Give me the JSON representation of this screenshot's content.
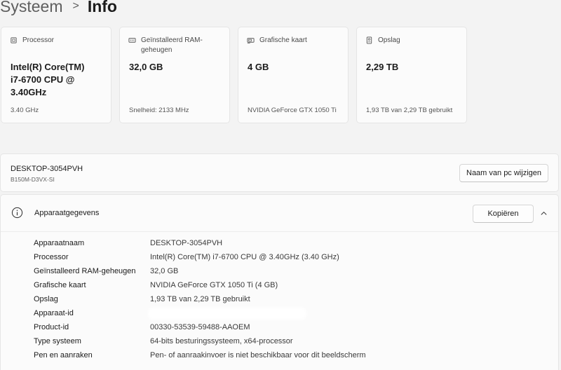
{
  "breadcrumb": {
    "parent": "Systeem",
    "separator": ">",
    "current": "Info"
  },
  "cards": [
    {
      "icon": "processor-icon",
      "title": "Processor",
      "value": "Intel(R) Core(TM) i7-6700 CPU @ 3.40GHz",
      "sub": "3.40 GHz"
    },
    {
      "icon": "ram-icon",
      "title": "Geïnstalleerd RAM-geheugen",
      "value": "32,0 GB",
      "sub": "Snelheid: 2133 MHz"
    },
    {
      "icon": "graphics-card-icon",
      "title": "Grafische kaart",
      "value": "4 GB",
      "sub": "NVIDIA GeForce GTX 1050 Ti"
    },
    {
      "icon": "storage-icon",
      "title": "Opslag",
      "value": "2,29 TB",
      "sub": "1,93 TB van 2,29 TB gebruikt"
    }
  ],
  "device": {
    "name": "DESKTOP-3054PVH",
    "model": "B150M-D3VX-SI",
    "rename_label": "Naam van pc wijzigen"
  },
  "specs": {
    "title": "Apparaatgegevens",
    "copy_label": "Kopiëren",
    "rows": [
      {
        "label": "Apparaatnaam",
        "value": "DESKTOP-3054PVH"
      },
      {
        "label": "Processor",
        "value": "Intel(R) Core(TM) i7-6700 CPU @ 3.40GHz (3.40 GHz)"
      },
      {
        "label": "Geïnstalleerd RAM-geheugen",
        "value": "32,0 GB"
      },
      {
        "label": "Grafische kaart",
        "value": "NVIDIA GeForce GTX 1050 Ti (4 GB)"
      },
      {
        "label": "Opslag",
        "value": "1,93 TB van 2,29 TB gebruikt"
      },
      {
        "label": "Apparaat-id",
        "value": ""
      },
      {
        "label": "Product-id",
        "value": "00330-53539-59488-AAOEM"
      },
      {
        "label": "Type systeem",
        "value": "64-bits besturingssysteem, x64-processor"
      },
      {
        "label": "Pen en aanraken",
        "value": "Pen- of aanraakinvoer is niet beschikbaar voor dit beeldscherm"
      }
    ]
  }
}
